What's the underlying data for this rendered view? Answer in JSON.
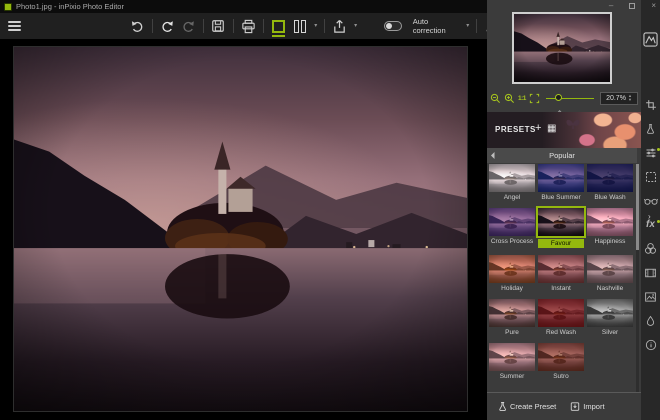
{
  "accent": "#94b80e",
  "window": {
    "title": "Photo1.jpg - inPixio Photo Editor"
  },
  "toolbar": {
    "auto_correction": "Auto correction"
  },
  "preview": {
    "zoom_value": "20.7%",
    "actual_size": "1:1"
  },
  "presets_panel": {
    "title": "PRESETS",
    "category": "Popular",
    "create_preset": "Create Preset",
    "import": "Import",
    "items": [
      {
        "name": "Angel",
        "filter": "brightness(1.8) saturate(0.3)",
        "tint": "rgba(235,228,228,0.35)"
      },
      {
        "name": "Blue Summer",
        "filter": "brightness(1.05) saturate(1.3)",
        "tint": "rgba(25,60,190,0.4)"
      },
      {
        "name": "Blue Wash",
        "filter": "brightness(0.75)",
        "tint": "rgba(20,30,110,0.55)"
      },
      {
        "name": "Cross Process",
        "filter": "brightness(1.1)",
        "tint": "rgba(110,70,190,0.35)"
      },
      {
        "name": "Favour",
        "filter": "none",
        "tint": "rgba(0,0,0,0)",
        "selected": true
      },
      {
        "name": "Happiness",
        "filter": "brightness(1.55) saturate(1.1)",
        "tint": "rgba(255,160,190,0.35)"
      },
      {
        "name": "Holiday",
        "filter": "brightness(1.2) saturate(1.5)",
        "tint": "rgba(235,120,40,0.35)"
      },
      {
        "name": "Instant",
        "filter": "brightness(1.15)",
        "tint": "rgba(205,95,85,0.35)"
      },
      {
        "name": "Nashville",
        "filter": "brightness(1.3) saturate(0.65)",
        "tint": "rgba(225,175,175,0.3)"
      },
      {
        "name": "Pure",
        "filter": "brightness(1.15) saturate(1.15)",
        "tint": "rgba(245,185,145,0.18)"
      },
      {
        "name": "Red Wash",
        "filter": "brightness(0.85)",
        "tint": "rgba(160,25,25,0.5)"
      },
      {
        "name": "Silver",
        "filter": "grayscale(1) brightness(1.25)",
        "tint": "rgba(205,205,205,0.18)"
      },
      {
        "name": "Summer",
        "filter": "brightness(1.35)",
        "tint": "rgba(245,175,165,0.3)"
      },
      {
        "name": "Sutro",
        "filter": "brightness(0.95) saturate(1.15)",
        "tint": "rgba(170,75,45,0.4)"
      }
    ]
  },
  "sidebar": {
    "items": [
      {
        "icon": "histogram-icon"
      },
      {
        "icon": "crop-icon"
      },
      {
        "icon": "flask-icon"
      },
      {
        "icon": "adjustments-icon",
        "badge": true
      },
      {
        "icon": "selection-icon"
      },
      {
        "icon": "glasses-icon"
      },
      {
        "icon": "fx-icon",
        "badge": true
      },
      {
        "icon": "color-circles-icon"
      },
      {
        "icon": "film-strip-icon"
      },
      {
        "icon": "photo-frame-icon"
      },
      {
        "icon": "ink-drop-icon"
      },
      {
        "icon": "info-icon"
      }
    ]
  }
}
